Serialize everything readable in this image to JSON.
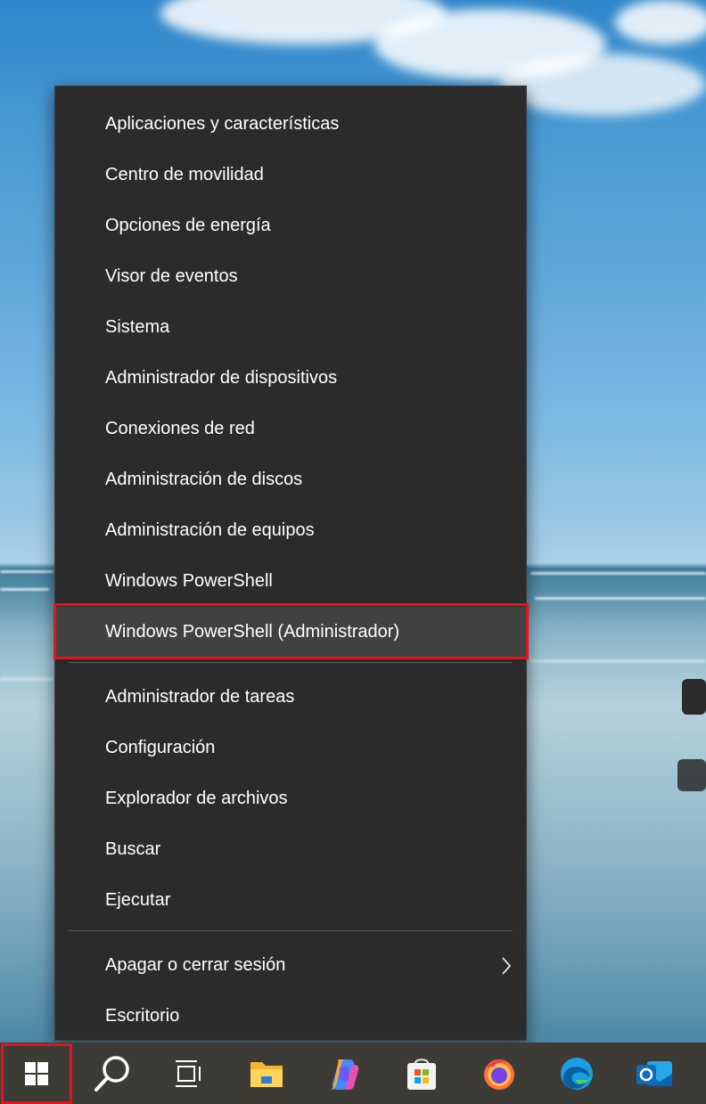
{
  "context_menu": {
    "group1": [
      {
        "label": "Aplicaciones y características"
      },
      {
        "label": "Centro de movilidad"
      },
      {
        "label": "Opciones de energía"
      },
      {
        "label": "Visor de eventos"
      },
      {
        "label": "Sistema"
      },
      {
        "label": "Administrador de dispositivos"
      },
      {
        "label": "Conexiones de red"
      },
      {
        "label": "Administración de discos"
      },
      {
        "label": "Administración de equipos"
      },
      {
        "label": "Windows PowerShell"
      },
      {
        "label": "Windows PowerShell (Administrador)"
      }
    ],
    "group2": [
      {
        "label": "Administrador de tareas"
      },
      {
        "label": "Configuración"
      },
      {
        "label": "Explorador de archivos"
      },
      {
        "label": "Buscar"
      },
      {
        "label": "Ejecutar"
      }
    ],
    "group3": [
      {
        "label": "Apagar o cerrar sesión"
      },
      {
        "label": "Escritorio"
      }
    ],
    "highlighted_item": "Windows PowerShell (Administrador)"
  },
  "taskbar": {
    "icons": [
      "windows-start-icon",
      "search-icon",
      "task-view-icon",
      "file-explorer-icon",
      "copilot-icon",
      "microsoft-store-icon",
      "firefox-icon",
      "edge-icon",
      "outlook-icon"
    ]
  },
  "colors": {
    "menu_bg": "#2b2b2b",
    "menu_hover": "#414141",
    "highlight_border": "#e2151f",
    "taskbar_bg": "#3d3b36"
  }
}
